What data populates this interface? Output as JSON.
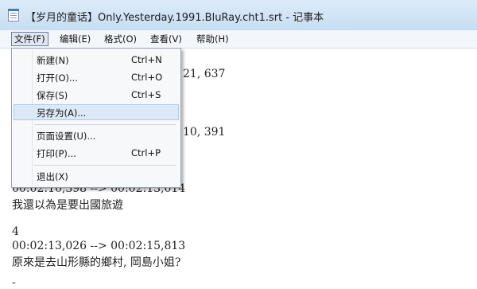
{
  "window": {
    "title": "【岁月的童话】Only.Yesterday.1991.BluRay.cht1.srt - 记事本"
  },
  "menubar": {
    "items": [
      {
        "label": "文件(F)",
        "active": true
      },
      {
        "label": "编辑(E)"
      },
      {
        "label": "格式(O)"
      },
      {
        "label": "查看(V)"
      },
      {
        "label": "帮助(H)"
      }
    ]
  },
  "file_menu": {
    "items": [
      {
        "label": "新建(N)",
        "shortcut": "Ctrl+N"
      },
      {
        "label": "打开(O)...",
        "shortcut": "Ctrl+O"
      },
      {
        "label": "保存(S)",
        "shortcut": "Ctrl+S"
      },
      {
        "label": "另存为(A)...",
        "shortcut": "",
        "highlighted": true
      },
      {
        "label": "页面设置(U)...",
        "shortcut": ""
      },
      {
        "label": "打印(P)...",
        "shortcut": "Ctrl+P"
      },
      {
        "label": "退出(X)",
        "shortcut": ""
      }
    ]
  },
  "editor": {
    "partial_lines": [
      "21, 637",
      "10, 391"
    ],
    "lines": [
      "00:02:10,398 --> 00:02:13,014",
      "我還以為是要出國旅遊",
      "",
      "4",
      "00:02:13,026 --> 00:02:15,813",
      "原來是去山形縣的鄉村, 岡島小姐?",
      "",
      "-"
    ]
  },
  "colors": {
    "highlight": "#dceaf8",
    "titlebar": "#dcebf9"
  }
}
